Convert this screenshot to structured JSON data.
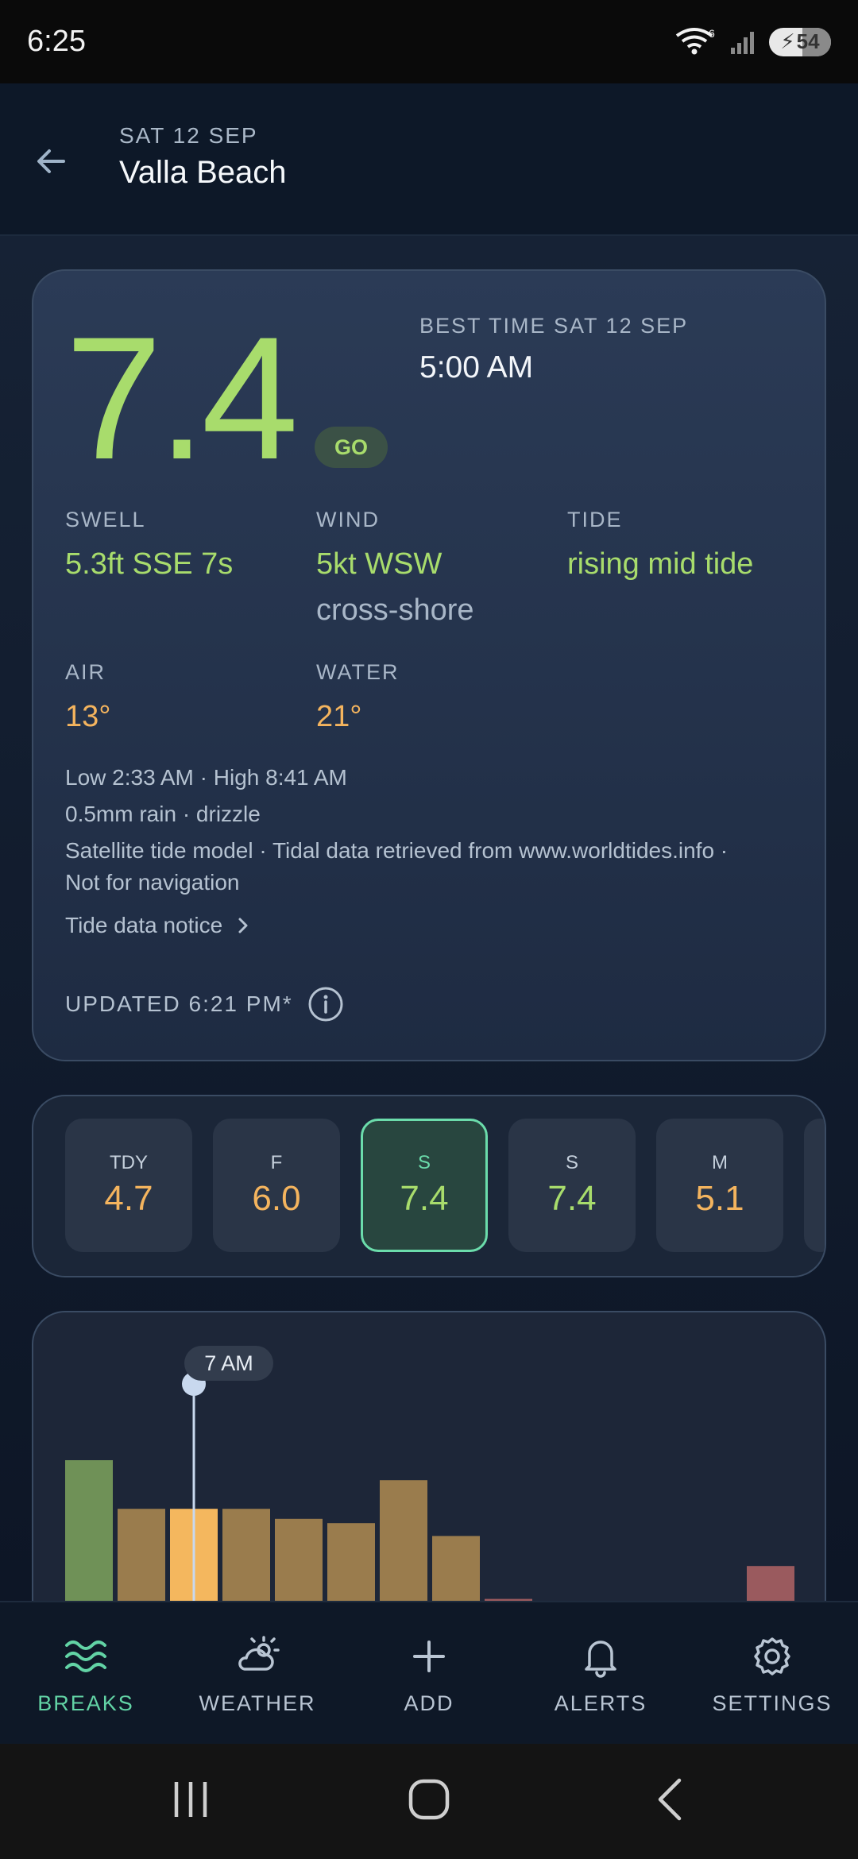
{
  "status_bar": {
    "time": "6:25",
    "battery": "54",
    "wifi_badge": "6"
  },
  "header": {
    "date": "SAT 12 SEP",
    "title": "Valla Beach"
  },
  "card": {
    "score": "7.4",
    "verdict": "GO",
    "best_time_label": "BEST TIME SAT 12 SEP",
    "best_time": "5:00 AM",
    "swell_label": "SWELL",
    "swell_value": "5.3ft SSE 7s",
    "wind_label": "WIND",
    "wind_value": "5kt WSW",
    "wind_sub": "cross-shore",
    "tide_label": "TIDE",
    "tide_value": "rising mid tide",
    "air_label": "AIR",
    "air_value": "13°",
    "water_label": "WATER",
    "water_value": "21°",
    "tides_line": "Low 2:33 AM · High 8:41 AM",
    "rain_line": "0.5mm rain · drizzle",
    "source_line1": "Satellite tide model · Tidal data retrieved from www.worldtides.info ·",
    "source_line2": "Not for navigation",
    "tide_notice": "Tide data notice",
    "updated": "UPDATED 6:21 PM*"
  },
  "days": [
    {
      "label": "TDY",
      "value": "4.7",
      "color": "#f4b45e"
    },
    {
      "label": "F",
      "value": "6.0",
      "color": "#f4b45e"
    },
    {
      "label": "S",
      "value": "7.4",
      "color": "#a8dc6c",
      "selected": true
    },
    {
      "label": "S",
      "value": "7.4",
      "color": "#a8dc6c"
    },
    {
      "label": "M",
      "value": "5.1",
      "color": "#f4b45e"
    }
  ],
  "chart": {
    "tooltip": "7 AM",
    "selected_index": 2
  },
  "chart_data": {
    "type": "bar",
    "values": [
      10,
      6.6,
      6.6,
      6.6,
      5.9,
      5.6,
      8.6,
      4.7,
      0.3,
      0,
      0,
      0,
      0,
      2.6
    ],
    "colors": [
      "#6f9157",
      "#9a7c4d",
      "#f4b75e",
      "#9a7c4d",
      "#9a7c4d",
      "#9a7c4d",
      "#9a7c4d",
      "#9a7c4d",
      "#9a5a5e",
      "#9a5a5e",
      "#9a5a5e",
      "#9a5a5e",
      "#9a5a5e",
      "#9a5a5e"
    ],
    "ylim": [
      0,
      10
    ]
  },
  "nav": [
    {
      "label": "BREAKS",
      "icon": "waves-icon",
      "active": true
    },
    {
      "label": "WEATHER",
      "icon": "weather-icon"
    },
    {
      "label": "ADD",
      "icon": "plus-icon"
    },
    {
      "label": "ALERTS",
      "icon": "bell-icon"
    },
    {
      "label": "SETTINGS",
      "icon": "gear-icon"
    }
  ]
}
